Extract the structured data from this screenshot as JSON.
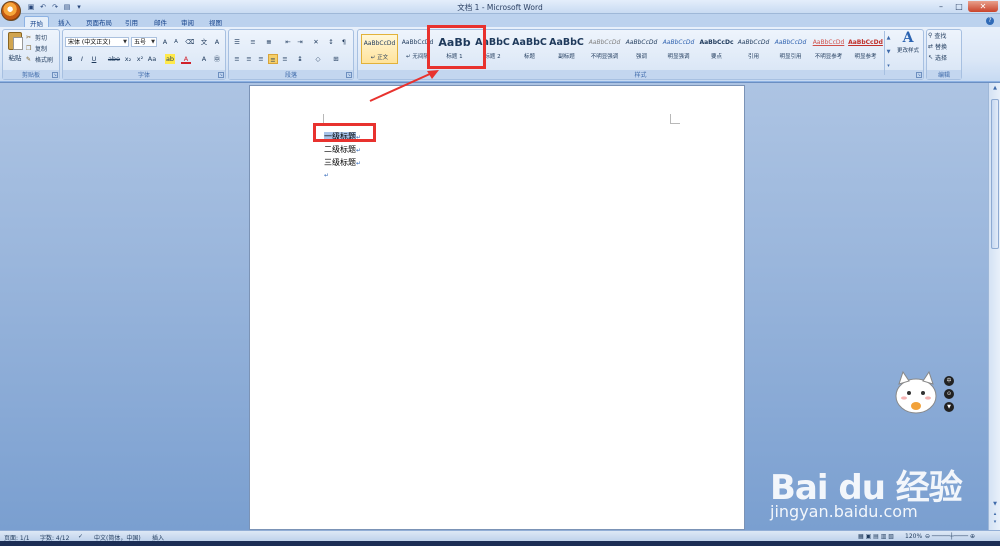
{
  "window": {
    "title": "文档 1 - Microsoft Word"
  },
  "tabs": [
    "开始",
    "插入",
    "页面布局",
    "引用",
    "邮件",
    "审阅",
    "视图"
  ],
  "clipboard": {
    "paste": "粘贴",
    "cut": "剪切",
    "copy": "复制",
    "format_painter": "格式刷",
    "label": "剪贴板"
  },
  "font": {
    "family": "宋体 (中文正文)",
    "size": "五号",
    "grow": "A",
    "shrink": "A",
    "label": "字体",
    "bold": "B",
    "italic": "I",
    "underline": "U",
    "strike": "abe",
    "subscript": "x₂",
    "superscript": "x²",
    "case": "Aa",
    "font_color": "A"
  },
  "paragraph": {
    "label": "段落"
  },
  "styles": {
    "label": "样式",
    "items": [
      {
        "sample": "AaBbCcDd",
        "name": "↵ 正文"
      },
      {
        "sample": "AaBbCcDd",
        "name": "↵ 无间隔"
      },
      {
        "sample": "AaBb",
        "name": "标题 1"
      },
      {
        "sample": "AaBbC",
        "name": "标题 2"
      },
      {
        "sample": "AaBbC",
        "name": "标题"
      },
      {
        "sample": "AaBbC",
        "name": "副标题"
      },
      {
        "sample": "AaBbCcDd",
        "name": "不明显强调"
      },
      {
        "sample": "AaBbCcDd",
        "name": "强调"
      },
      {
        "sample": "AaBbCcDd",
        "name": "明显强调"
      },
      {
        "sample": "AaBbCcDc",
        "name": "要点"
      },
      {
        "sample": "AaBbCcDd",
        "name": "引用"
      },
      {
        "sample": "AaBbCcDd",
        "name": "明显引用"
      },
      {
        "sample": "AaBbCcDd",
        "name": "不明显参考"
      },
      {
        "sample": "AaBbCcDd",
        "name": "明显参考"
      }
    ],
    "change_styles": "更改样式"
  },
  "editing": {
    "label": "编辑",
    "find": "查找",
    "replace": "替换",
    "select": "选择"
  },
  "document": {
    "lines": [
      "一级标题",
      "二级标题",
      "三级标题",
      ""
    ]
  },
  "statusbar": {
    "page": "页面: 1/1",
    "words": "字数: 4/12",
    "language": "中文(简体，中国)",
    "mode": "插入",
    "zoom": "120%"
  },
  "watermark": {
    "brand": "Bai du 经验",
    "url": "jingyan.baidu.com"
  }
}
